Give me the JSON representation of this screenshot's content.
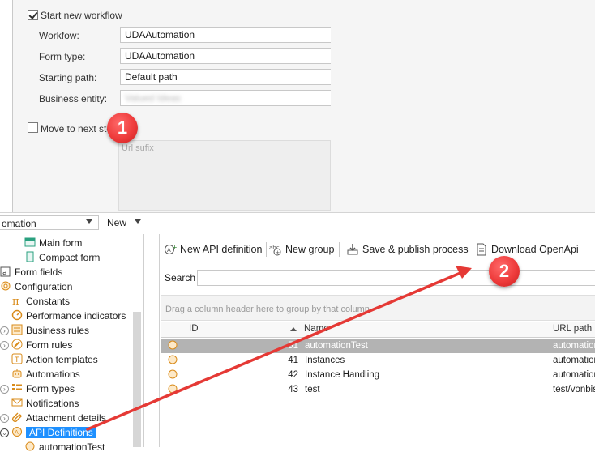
{
  "dialog": {
    "start_new_workflow": {
      "label": "Start new workflow",
      "checked": true
    },
    "workflow": {
      "label": "Workfow:",
      "value": "UDAAutomation"
    },
    "form_type": {
      "label": "Form type:",
      "value": "UDAAutomation"
    },
    "starting_path": {
      "label": "Starting path:",
      "value": "Default path"
    },
    "business_entity": {
      "label": "Business entity:",
      "value": "Valued Ideas"
    },
    "move_to_next_step": {
      "label": "Move to next step",
      "checked": false
    },
    "url_sufix": {
      "placeholder": "Url sufix"
    }
  },
  "strip": {
    "left_value": "omation",
    "new_button": "New"
  },
  "tree": {
    "items": [
      {
        "label": "Main form",
        "icon": "form-icon"
      },
      {
        "label": "Compact form",
        "icon": "form-icon"
      },
      {
        "label": "Form fields",
        "icon": "field-icon"
      },
      {
        "label": "Configuration",
        "icon": "gear-icon"
      },
      {
        "label": "Constants",
        "icon": "pi-icon"
      },
      {
        "label": "Performance indicators",
        "icon": "gauge-icon"
      },
      {
        "label": "Business rules",
        "icon": "rules-icon"
      },
      {
        "label": "Form rules",
        "icon": "pencil-icon"
      },
      {
        "label": "Action templates",
        "icon": "template-icon"
      },
      {
        "label": "Automations",
        "icon": "robot-icon"
      },
      {
        "label": "Form types",
        "icon": "list-icon"
      },
      {
        "label": "Notifications",
        "icon": "envelope-icon"
      },
      {
        "label": "Attachment details",
        "icon": "paperclip-icon"
      },
      {
        "label": "API Definitions",
        "icon": "api-icon"
      },
      {
        "label": "automationTest",
        "icon": "api-icon"
      }
    ]
  },
  "toolbar": {
    "new_api_definition": "New API definition",
    "new_group": "New group",
    "save_publish": "Save & publish process",
    "download_openapi": "Download OpenApi"
  },
  "search": {
    "label": "Search",
    "value": ""
  },
  "grid": {
    "group_hint": "Drag a column header here to group by that column",
    "columns": [
      "ID",
      "Name",
      "URL path"
    ],
    "rows": [
      {
        "id": "51",
        "name": "automationTest",
        "url": "automation",
        "selected": true
      },
      {
        "id": "41",
        "name": "Instances",
        "url": "automation",
        "selected": false
      },
      {
        "id": "42",
        "name": "Instance Handling",
        "url": "automation",
        "selected": false
      },
      {
        "id": "43",
        "name": "test",
        "url": "test/vonbis",
        "selected": false
      }
    ]
  },
  "callouts": [
    "1",
    "2"
  ],
  "colors": {
    "selection": "#1e90ff",
    "callout": "#ee3b3b",
    "arrow": "#e53935"
  }
}
